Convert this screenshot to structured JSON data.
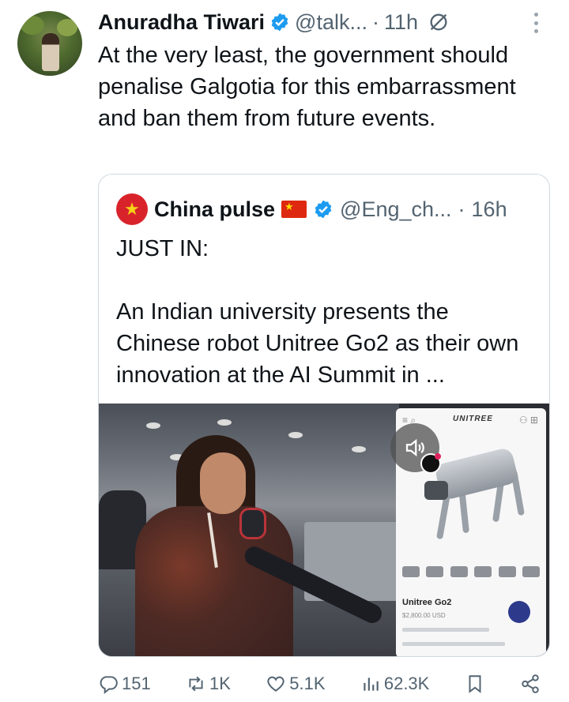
{
  "tweet": {
    "author_name": "Anuradha Tiwari",
    "handle": "@talk...",
    "separator": "·",
    "time": "11h",
    "text": "At the very least, the government should penalise Galgotia for this embarrassment and ban them from future events."
  },
  "quoted_tweet": {
    "author_name": "China pulse",
    "handle": "@Eng_ch...",
    "separator": "·",
    "time": "16h",
    "text": "JUST IN:\n\nAn Indian university presents the Chinese robot Unitree Go2 as their own innovation at the AI Summit in ...",
    "media": {
      "brand": "UNITREE",
      "product_name": "Unitree Go2",
      "price": "$2,800.00 USD"
    }
  },
  "actions": {
    "replies": "151",
    "reposts": "1K",
    "likes": "5.1K",
    "views": "62.3K"
  },
  "colors": {
    "text": "#0f1419",
    "muted": "#536471",
    "verified": "#1d9bf0",
    "border": "#cfd9de"
  },
  "icons": [
    "verified-badge-icon",
    "grok-icon",
    "more-options-icon",
    "reply-icon",
    "repost-icon",
    "like-icon",
    "views-icon",
    "bookmark-icon",
    "share-icon",
    "mute-icon",
    "china-flag-icon"
  ]
}
